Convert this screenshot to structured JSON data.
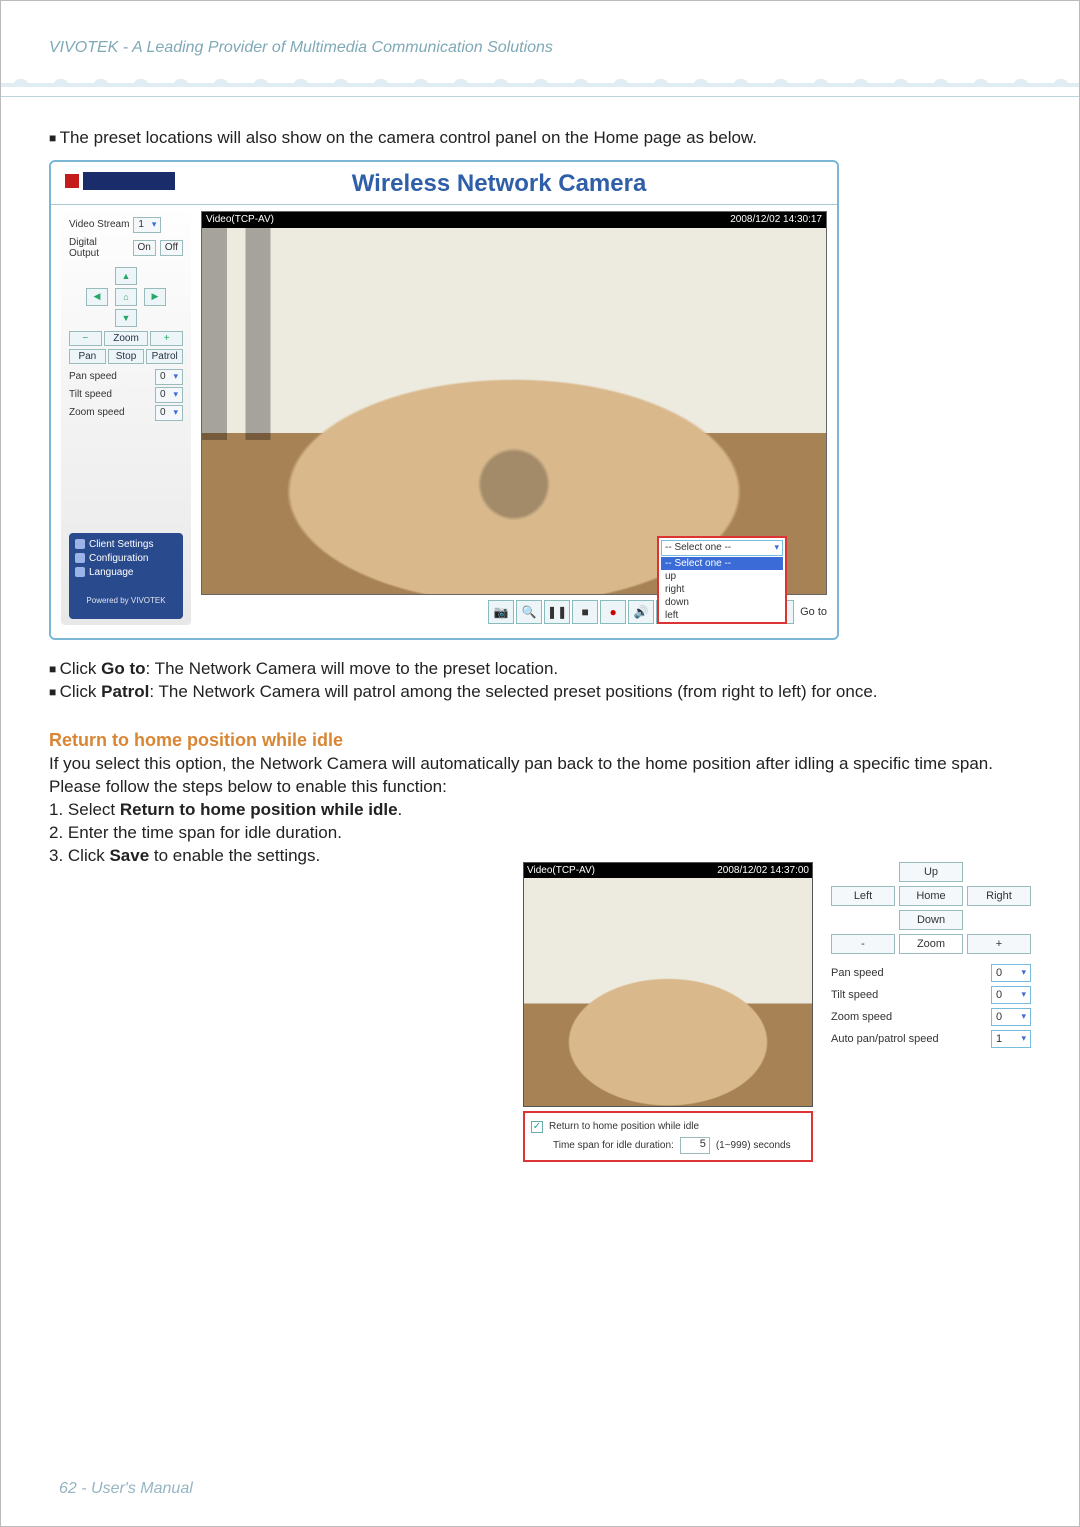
{
  "header": {
    "tagline": "VIVOTEK - A Leading Provider of Multimedia Communication Solutions"
  },
  "intro": {
    "line": "The preset locations will also show on the camera control panel on the Home page as below."
  },
  "shot1": {
    "title": "Wireless Network Camera",
    "videoStream_label": "Video Stream",
    "videoStream_value": "1",
    "digitalOutput_label": "Digital Output",
    "digitalOutput_on": "On",
    "digitalOutput_off": "Off",
    "zoom_label": "Zoom",
    "pan_btn": "Pan",
    "stop_btn": "Stop",
    "patrol_btn": "Patrol",
    "speeds": {
      "pan": {
        "label": "Pan speed",
        "value": "0"
      },
      "tilt": {
        "label": "Tilt speed",
        "value": "0"
      },
      "zoom": {
        "label": "Zoom speed",
        "value": "0"
      }
    },
    "nav": {
      "client": "Client Settings",
      "config": "Configuration",
      "lang": "Language"
    },
    "powered": "Powered by VIVOTEK",
    "video": {
      "label": "Video(TCP-AV)",
      "timestamp": "2008/12/02 14:30:17"
    },
    "goto_label": "Go to",
    "goto_placeholder": "-- Select one --",
    "goto_options": [
      "-- Select one --",
      "up",
      "right",
      "down",
      "left"
    ]
  },
  "bullets": {
    "b1_a": "Click ",
    "b1_b": "Go to",
    "b1_c": ": The Network Camera will move to the preset location.",
    "b2_a": "Click ",
    "b2_b": "Patrol",
    "b2_c": ": The Network Camera will patrol among the selected preset positions (from right to left) for once."
  },
  "section": {
    "heading": "Return to home position while idle",
    "p1": "If you select this option, the Network Camera will automatically pan back to the home position after idling a specific time span.",
    "p2": "Please follow the steps below to enable this function:",
    "s1_a": "1. Select ",
    "s1_b": "Return to home position while idle",
    "s1_c": ".",
    "s2": "2. Enter the time span for idle duration.",
    "s3_a": "3. Click ",
    "s3_b": "Save",
    "s3_c": " to enable the settings."
  },
  "shot2": {
    "video": {
      "label": "Video(TCP-AV)",
      "timestamp": "2008/12/02 14:37:00"
    },
    "chk_label": "Return to home position while idle",
    "duration_label": "Time span for idle duration:",
    "duration_value": "5",
    "duration_hint": "(1~999) seconds",
    "ptz": {
      "up": "Up",
      "left": "Left",
      "home": "Home",
      "right": "Right",
      "down": "Down",
      "minus": "-",
      "zoom": "Zoom",
      "plus": "+",
      "pan": {
        "label": "Pan speed",
        "value": "0"
      },
      "tilt": {
        "label": "Tilt speed",
        "value": "0"
      },
      "zoomS": {
        "label": "Zoom speed",
        "value": "0"
      },
      "auto": {
        "label": "Auto pan/patrol speed",
        "value": "1"
      }
    }
  },
  "footer": {
    "text": "62 - User's Manual"
  }
}
